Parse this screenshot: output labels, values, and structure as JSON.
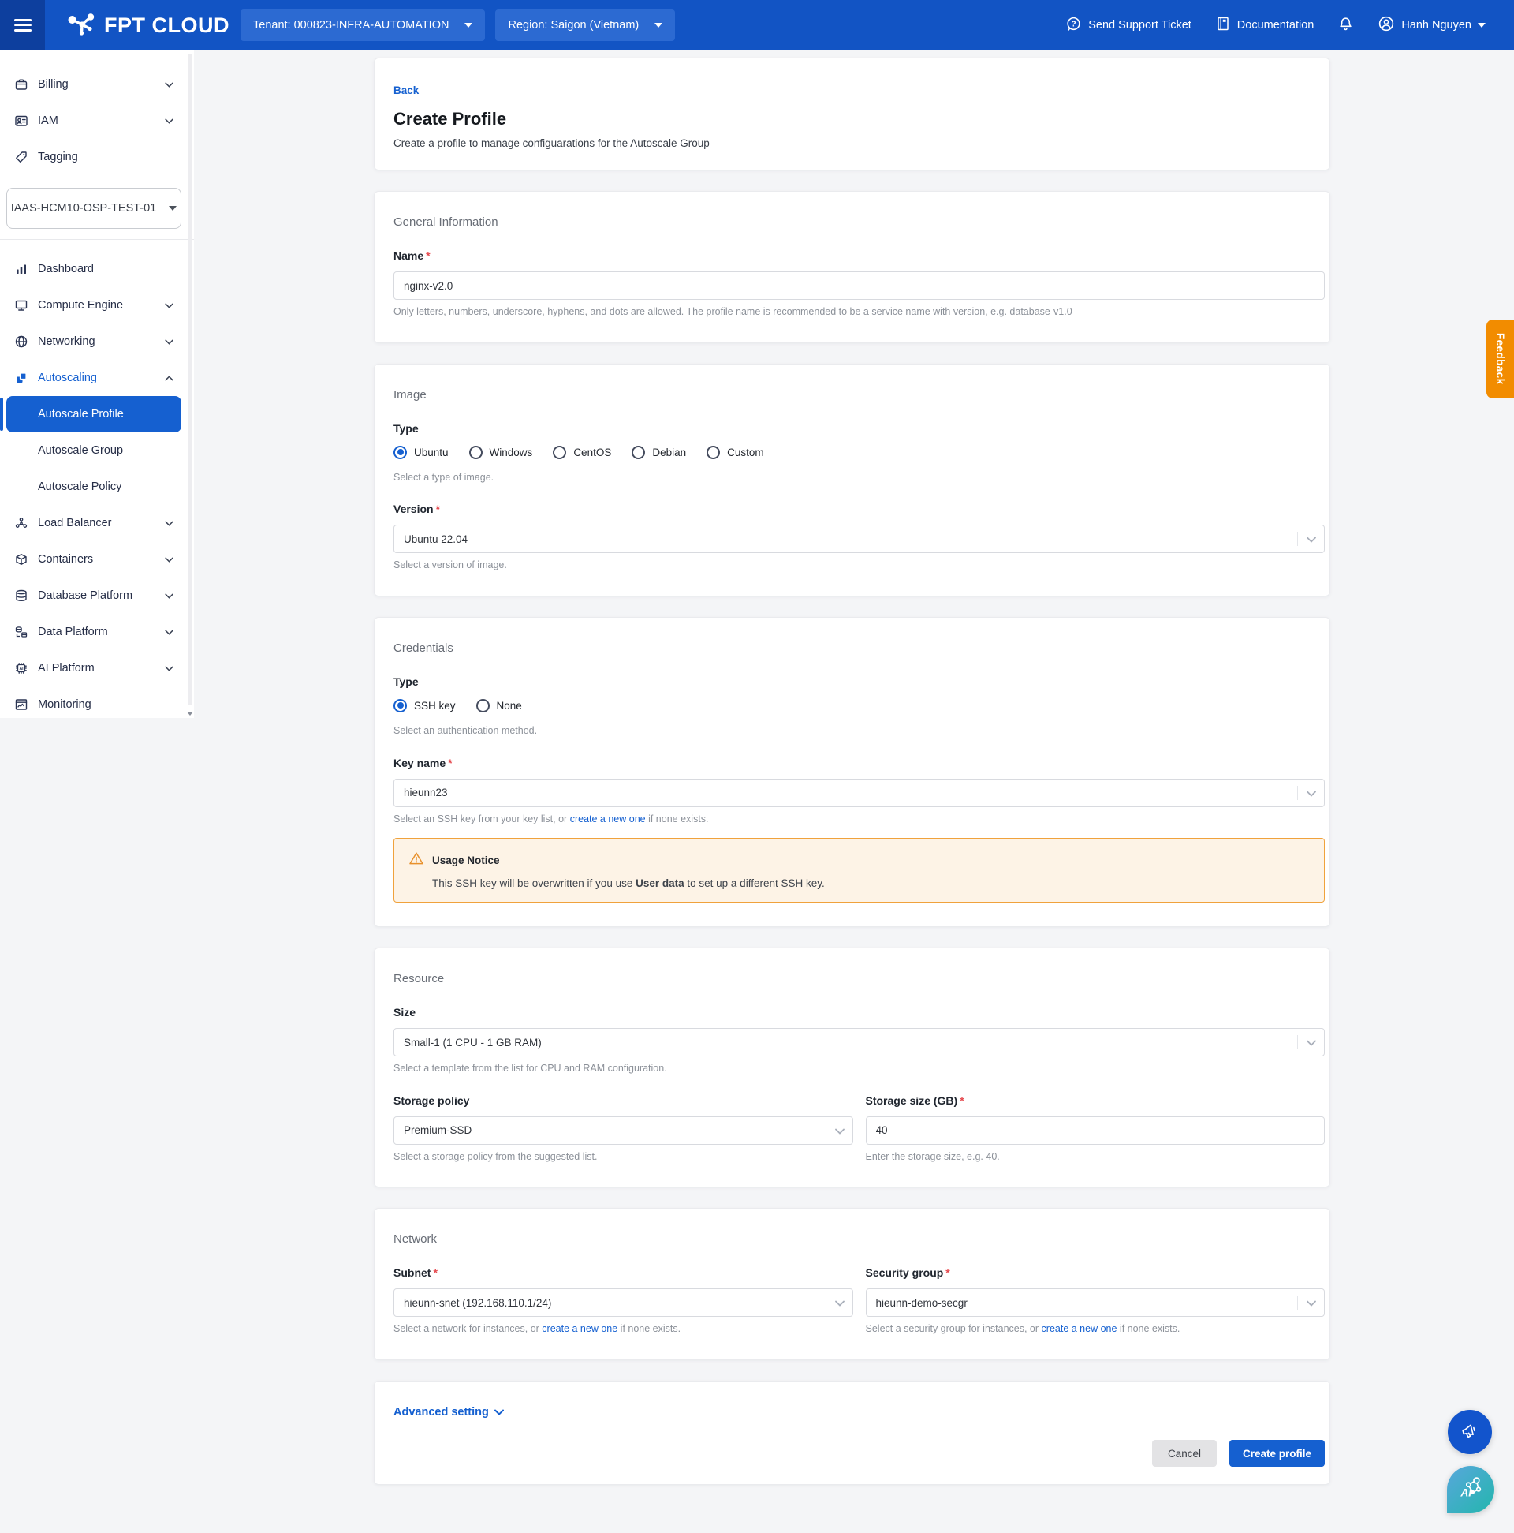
{
  "ui": {
    "required_mark": "*"
  },
  "header": {
    "brand": "FPT CLOUD",
    "tenant_label": "Tenant: 000823-INFRA-AUTOMATION",
    "region_label": "Region: Saigon (Vietnam)",
    "support_label": "Send Support Ticket",
    "documentation_label": "Documentation",
    "user_name": "Hanh Nguyen"
  },
  "sidebar": {
    "top_items": [
      {
        "label": "Billing"
      },
      {
        "label": "IAM"
      },
      {
        "label": "Tagging"
      }
    ],
    "project_selector": {
      "value": "IAAS-HCM10-OSP-TEST-01"
    },
    "items": [
      {
        "label": "Dashboard"
      },
      {
        "label": "Compute Engine"
      },
      {
        "label": "Networking"
      },
      {
        "label": "Autoscaling"
      },
      {
        "label": "Autoscale Profile"
      },
      {
        "label": "Autoscale Group"
      },
      {
        "label": "Autoscale Policy"
      },
      {
        "label": "Load Balancer"
      },
      {
        "label": "Containers"
      },
      {
        "label": "Database Platform"
      },
      {
        "label": "Data Platform"
      },
      {
        "label": "AI Platform"
      },
      {
        "label": "Monitoring"
      }
    ],
    "active_item": "Autoscale Profile"
  },
  "page": {
    "back": "Back",
    "title": "Create Profile",
    "subtitle": "Create a profile to manage configuarations for the Autoscale Group"
  },
  "sections": {
    "general": {
      "heading": "General Information",
      "name_label": "Name",
      "name_value": "nginx-v2.0",
      "name_help": "Only letters, numbers, underscore, hyphens, and dots are allowed. The profile name is recommended to be a service name with version, e.g. database-v1.0"
    },
    "image": {
      "heading": "Image",
      "type_label": "Type",
      "types": [
        "Ubuntu",
        "Windows",
        "CentOS",
        "Debian",
        "Custom"
      ],
      "selected_type": "Ubuntu",
      "type_help": "Select a type of image.",
      "version_label": "Version",
      "version_value": "Ubuntu 22.04",
      "version_help": "Select a version of image."
    },
    "credentials": {
      "heading": "Credentials",
      "type_label": "Type",
      "types": [
        "SSH key",
        "None"
      ],
      "selected_type": "SSH key",
      "type_help": "Select an authentication method.",
      "key_label": "Key name",
      "key_value": "hieunn23",
      "key_help_prefix": "Select an SSH key from your key list, or ",
      "key_help_link": "create a new one",
      "key_help_suffix": " if none exists.",
      "notice": {
        "title": "Usage Notice",
        "body_pre": "This SSH key will be overwritten if you use ",
        "body_bold": "User data",
        "body_post": " to set up a different SSH key."
      }
    },
    "resource": {
      "heading": "Resource",
      "size_label": "Size",
      "size_value": "Small-1 (1 CPU - 1 GB RAM)",
      "size_help": "Select a template from the list for CPU and RAM configuration.",
      "storage_policy_label": "Storage policy",
      "storage_policy_value": "Premium-SSD",
      "storage_policy_help": "Select a storage policy from the suggested list.",
      "storage_size_label": "Storage size (GB)",
      "storage_size_value": "40",
      "storage_size_help": "Enter the storage size, e.g. 40."
    },
    "network": {
      "heading": "Network",
      "subnet_label": "Subnet",
      "subnet_value": "hieunn-snet (192.168.110.1/24)",
      "subnet_help_prefix": "Select a network for instances, or ",
      "subnet_help_link": "create a new one",
      "subnet_help_suffix": " if none exists.",
      "secgroup_label": "Security group",
      "secgroup_value": "hieunn-demo-secgr",
      "secgroup_help_prefix": "Select a security group for instances, or ",
      "secgroup_help_link": "create a new one",
      "secgroup_help_suffix": " if none exists."
    },
    "advanced": {
      "label": "Advanced setting"
    }
  },
  "footer": {
    "cancel_label": "Cancel",
    "create_label": "Create profile"
  },
  "feedback_tab": {
    "label": "Feedback"
  },
  "colors": {
    "accent": "#1560d0",
    "header_blue": "#1254c4",
    "header_dark_blue": "#0d3f9e",
    "warning_border": "#f0a23c",
    "warning_bg": "#fdf3e6",
    "feedback_orange": "#f28c00",
    "fab_teal_gradient": [
      "#58a7dc",
      "#23b6ad"
    ]
  }
}
